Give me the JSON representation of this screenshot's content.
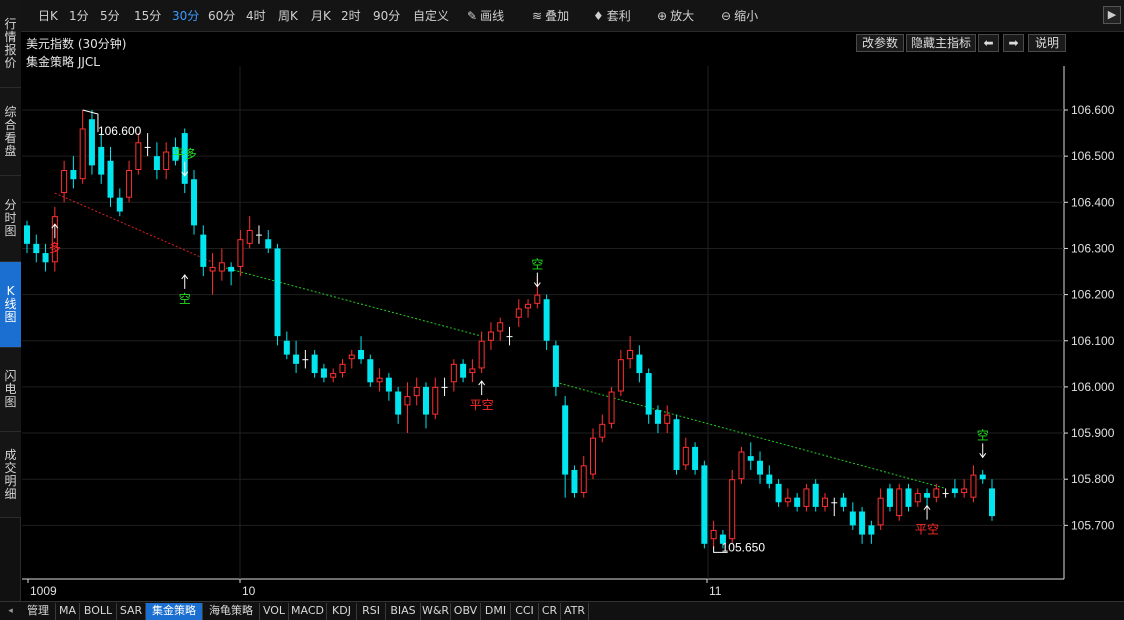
{
  "left_tabs": [
    {
      "chars": [
        "行",
        "情",
        "报",
        "价"
      ],
      "active": false
    },
    {
      "chars": [
        "综",
        "合",
        "看",
        "盘"
      ],
      "active": false
    },
    {
      "chars": [
        "分",
        "时",
        "图"
      ],
      "active": false
    },
    {
      "chars": [
        "K",
        "线",
        "图"
      ],
      "active": true
    },
    {
      "chars": [
        "闪",
        "电",
        "图"
      ],
      "active": false
    },
    {
      "chars": [
        "成",
        "交",
        "明",
        "细"
      ],
      "active": false
    }
  ],
  "toolbar": {
    "periods": [
      "日K",
      "1分",
      "5分",
      "15分",
      "30分",
      "60分",
      "4时",
      "周K",
      "月K",
      "2时",
      "90分",
      "自定义"
    ],
    "active_period": "30分",
    "draw": "画线",
    "overlay": "叠加",
    "arbitrage": "套利",
    "zoom_in": "放大",
    "zoom_out": "缩小",
    "collapse": "▶"
  },
  "header": {
    "title": "美元指数 (30分钟)",
    "strategy": "集金策略 JJCL",
    "edit_params": "改参数",
    "hide_indicator": "隐藏主指标",
    "prev": "⬅",
    "next": "➡",
    "help": "说明"
  },
  "bottom_tabs": [
    "管理",
    "MA",
    "BOLL",
    "SAR",
    "集金策略",
    "海龟策略",
    "VOL",
    "MACD",
    "KDJ",
    "RSI",
    "BIAS",
    "W&R",
    "OBV",
    "DMI",
    "CCI",
    "CR",
    "ATR"
  ],
  "active_bottom_tab": "集金策略",
  "colors": {
    "up": "#ff3030",
    "down": "#00e5ee",
    "grid": "#1f1f1f",
    "axis": "#dcdcdc",
    "green": "#22dd22",
    "red": "#ff2a2a"
  },
  "chart_data": {
    "type": "candlestick",
    "y_ticks": [
      "106.600",
      "106.500",
      "106.400",
      "106.300",
      "106.200",
      "106.100",
      "106.000",
      "105.900",
      "105.800",
      "105.700"
    ],
    "x_labels": [
      "1009",
      "10",
      "11"
    ],
    "annotations": {
      "high": "106.600",
      "low": "105.650"
    },
    "signals": [
      {
        "text": "多",
        "color": "red"
      },
      {
        "text": "平多",
        "color": "green"
      },
      {
        "text": "空",
        "color": "green"
      },
      {
        "text": "平空",
        "color": "red"
      },
      {
        "text": "空",
        "color": "green"
      },
      {
        "text": "平空",
        "color": "red"
      },
      {
        "text": "空",
        "color": "green"
      }
    ],
    "candles": [
      [
        106.35,
        106.31,
        106.36,
        106.29
      ],
      [
        106.31,
        106.29,
        106.33,
        106.27
      ],
      [
        106.29,
        106.27,
        106.31,
        106.25
      ],
      [
        106.27,
        106.37,
        106.39,
        106.25
      ],
      [
        106.42,
        106.47,
        106.49,
        106.4
      ],
      [
        106.47,
        106.45,
        106.5,
        106.43
      ],
      [
        106.45,
        106.56,
        106.6,
        106.44
      ],
      [
        106.58,
        106.48,
        106.6,
        106.46
      ],
      [
        106.52,
        106.46,
        106.55,
        106.44
      ],
      [
        106.49,
        106.41,
        106.52,
        106.39
      ],
      [
        106.41,
        106.38,
        106.43,
        106.37
      ],
      [
        106.41,
        106.47,
        106.49,
        106.4
      ],
      [
        106.47,
        106.53,
        106.55,
        106.46
      ],
      [
        106.52,
        106.52,
        106.55,
        106.5
      ],
      [
        106.5,
        106.47,
        106.53,
        106.45
      ],
      [
        106.47,
        106.51,
        106.53,
        106.45
      ],
      [
        106.52,
        106.49,
        106.54,
        106.48
      ],
      [
        106.55,
        106.44,
        106.56,
        106.42
      ],
      [
        106.45,
        106.35,
        106.47,
        106.33
      ],
      [
        106.33,
        106.26,
        106.35,
        106.24
      ],
      [
        106.25,
        106.26,
        106.29,
        106.2
      ],
      [
        106.25,
        106.27,
        106.3,
        106.23
      ],
      [
        106.26,
        106.25,
        106.27,
        106.22
      ],
      [
        106.26,
        106.32,
        106.34,
        106.24
      ],
      [
        106.31,
        106.34,
        106.37,
        106.3
      ],
      [
        106.33,
        106.33,
        106.35,
        106.31
      ],
      [
        106.32,
        106.3,
        106.34,
        106.29
      ],
      [
        106.3,
        106.11,
        106.31,
        106.09
      ],
      [
        106.1,
        106.07,
        106.12,
        106.06
      ],
      [
        106.07,
        106.05,
        106.1,
        106.03
      ],
      [
        106.06,
        106.06,
        106.08,
        106.04
      ],
      [
        106.07,
        106.03,
        106.08,
        106.02
      ],
      [
        106.04,
        106.02,
        106.05,
        106.01
      ],
      [
        106.02,
        106.03,
        106.04,
        106.01
      ],
      [
        106.03,
        106.05,
        106.06,
        106.02
      ],
      [
        106.06,
        106.07,
        106.08,
        106.04
      ],
      [
        106.08,
        106.06,
        106.11,
        106.05
      ],
      [
        106.06,
        106.01,
        106.07,
        106.0
      ],
      [
        106.01,
        106.02,
        106.04,
        105.99
      ],
      [
        106.02,
        105.99,
        106.03,
        105.97
      ],
      [
        105.99,
        105.94,
        106.0,
        105.92
      ],
      [
        105.96,
        105.98,
        106.01,
        105.9
      ],
      [
        105.98,
        106.0,
        106.02,
        105.96
      ],
      [
        106.0,
        105.94,
        106.01,
        105.91
      ],
      [
        105.94,
        106.0,
        106.02,
        105.93
      ],
      [
        106.0,
        106.0,
        106.02,
        105.98
      ],
      [
        106.01,
        106.05,
        106.06,
        105.99
      ],
      [
        106.05,
        106.02,
        106.06,
        106.01
      ],
      [
        106.03,
        106.04,
        106.06,
        106.01
      ],
      [
        106.04,
        106.1,
        106.12,
        106.03
      ],
      [
        106.1,
        106.12,
        106.14,
        106.08
      ],
      [
        106.12,
        106.14,
        106.15,
        106.1
      ],
      [
        106.11,
        106.11,
        106.13,
        106.09
      ],
      [
        106.15,
        106.17,
        106.19,
        106.13
      ],
      [
        106.17,
        106.18,
        106.19,
        106.15
      ],
      [
        106.18,
        106.2,
        106.24,
        106.17
      ],
      [
        106.19,
        106.1,
        106.2,
        106.08
      ],
      [
        106.09,
        106.0,
        106.1,
        105.98
      ],
      [
        105.96,
        105.81,
        105.98,
        105.76
      ],
      [
        105.82,
        105.77,
        105.83,
        105.76
      ],
      [
        105.77,
        105.83,
        105.85,
        105.76
      ],
      [
        105.81,
        105.89,
        105.91,
        105.8
      ],
      [
        105.89,
        105.92,
        105.94,
        105.88
      ],
      [
        105.92,
        105.99,
        106.0,
        105.91
      ],
      [
        105.99,
        106.06,
        106.08,
        105.98
      ],
      [
        106.06,
        106.08,
        106.11,
        106.04
      ],
      [
        106.07,
        106.03,
        106.09,
        106.01
      ],
      [
        106.03,
        105.94,
        106.04,
        105.92
      ],
      [
        105.95,
        105.92,
        105.96,
        105.9
      ],
      [
        105.92,
        105.94,
        105.96,
        105.9
      ],
      [
        105.93,
        105.82,
        105.94,
        105.81
      ],
      [
        105.83,
        105.87,
        105.89,
        105.82
      ],
      [
        105.87,
        105.82,
        105.88,
        105.81
      ],
      [
        105.83,
        105.66,
        105.84,
        105.65
      ],
      [
        105.67,
        105.69,
        105.71,
        105.65
      ],
      [
        105.68,
        105.66,
        105.69,
        105.65
      ],
      [
        105.67,
        105.8,
        105.82,
        105.66
      ],
      [
        105.8,
        105.86,
        105.87,
        105.79
      ],
      [
        105.85,
        105.84,
        105.88,
        105.82
      ],
      [
        105.84,
        105.81,
        105.86,
        105.79
      ],
      [
        105.81,
        105.79,
        105.83,
        105.78
      ],
      [
        105.79,
        105.75,
        105.8,
        105.74
      ],
      [
        105.75,
        105.76,
        105.78,
        105.74
      ],
      [
        105.76,
        105.74,
        105.77,
        105.73
      ],
      [
        105.74,
        105.78,
        105.79,
        105.73
      ],
      [
        105.79,
        105.74,
        105.8,
        105.73
      ],
      [
        105.74,
        105.76,
        105.77,
        105.73
      ],
      [
        105.75,
        105.75,
        105.76,
        105.72
      ],
      [
        105.76,
        105.74,
        105.77,
        105.73
      ],
      [
        105.73,
        105.7,
        105.75,
        105.69
      ],
      [
        105.73,
        105.68,
        105.74,
        105.66
      ],
      [
        105.7,
        105.68,
        105.71,
        105.66
      ],
      [
        105.7,
        105.76,
        105.78,
        105.69
      ],
      [
        105.78,
        105.74,
        105.79,
        105.73
      ],
      [
        105.72,
        105.78,
        105.79,
        105.71
      ],
      [
        105.78,
        105.74,
        105.79,
        105.73
      ],
      [
        105.75,
        105.77,
        105.78,
        105.74
      ],
      [
        105.77,
        105.76,
        105.78,
        105.74
      ],
      [
        105.76,
        105.78,
        105.79,
        105.75
      ],
      [
        105.77,
        105.77,
        105.78,
        105.76
      ],
      [
        105.78,
        105.77,
        105.8,
        105.76
      ],
      [
        105.77,
        105.78,
        105.8,
        105.76
      ],
      [
        105.76,
        105.81,
        105.83,
        105.75
      ],
      [
        105.81,
        105.8,
        105.82,
        105.79
      ],
      [
        105.78,
        105.72,
        105.8,
        105.71
      ]
    ]
  }
}
